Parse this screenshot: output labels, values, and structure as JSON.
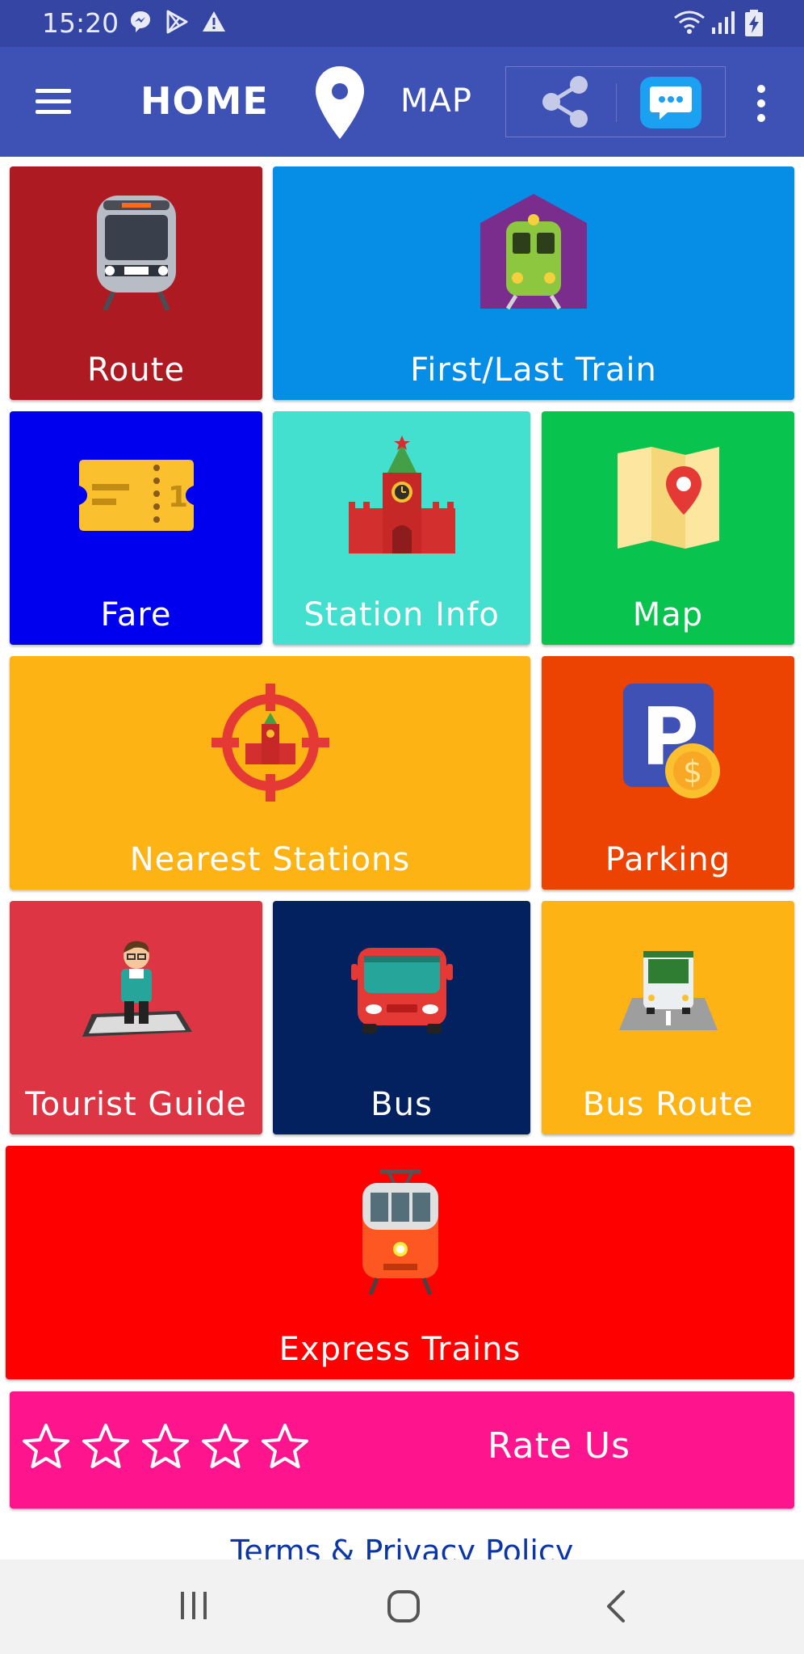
{
  "status_bar": {
    "time": "15:20",
    "icons": [
      "messenger-icon",
      "play-protect-icon",
      "warning-icon",
      "wifi-icon",
      "signal-icon",
      "battery-charging-icon"
    ]
  },
  "app_bar": {
    "menu_icon": "hamburger-menu-icon",
    "home_title": "HOME",
    "map_icon": "location-pin-icon",
    "map_label": "MAP",
    "share_icon": "share-icon",
    "chat_icon": "chat-bubble-icon",
    "overflow_icon": "more-vertical-icon"
  },
  "tiles": [
    {
      "id": "route",
      "label": "Route",
      "icon": "metro-train-icon",
      "color": "#ad1a22"
    },
    {
      "id": "first_last",
      "label": "First/Last Train",
      "icon": "train-depot-icon",
      "color": "#068de6"
    },
    {
      "id": "fare",
      "label": "Fare",
      "icon": "ticket-icon",
      "color": "#0000ee"
    },
    {
      "id": "station_info",
      "label": "Station Info",
      "icon": "kremlin-tower-icon",
      "color": "#43e0cf"
    },
    {
      "id": "map",
      "label": "Map",
      "icon": "folded-map-icon",
      "color": "#08c34e"
    },
    {
      "id": "nearest",
      "label": "Nearest Stations",
      "icon": "crosshair-target-icon",
      "color": "#fdb314"
    },
    {
      "id": "parking",
      "label": "Parking",
      "icon": "parking-coin-icon",
      "color": "#ec4303"
    },
    {
      "id": "tourist",
      "label": "Tourist Guide",
      "icon": "tourist-man-icon",
      "color": "#dd3544"
    },
    {
      "id": "bus",
      "label": "Bus",
      "icon": "red-bus-icon",
      "color": "#03205f"
    },
    {
      "id": "bus_route",
      "label": "Bus Route",
      "icon": "bus-road-icon",
      "color": "#fdb314"
    },
    {
      "id": "express",
      "label": "Express Trains",
      "icon": "tram-icon",
      "color": "#ff0000"
    }
  ],
  "rate": {
    "label": "Rate Us",
    "star_icon": "star-outline-icon",
    "stars": 5,
    "color": "#fe148d"
  },
  "terms_link": "Terms & Privacy Policy",
  "nav_bar": {
    "recents_icon": "recents-icon",
    "home_icon": "home-circle-icon",
    "back_icon": "back-chevron-icon"
  }
}
